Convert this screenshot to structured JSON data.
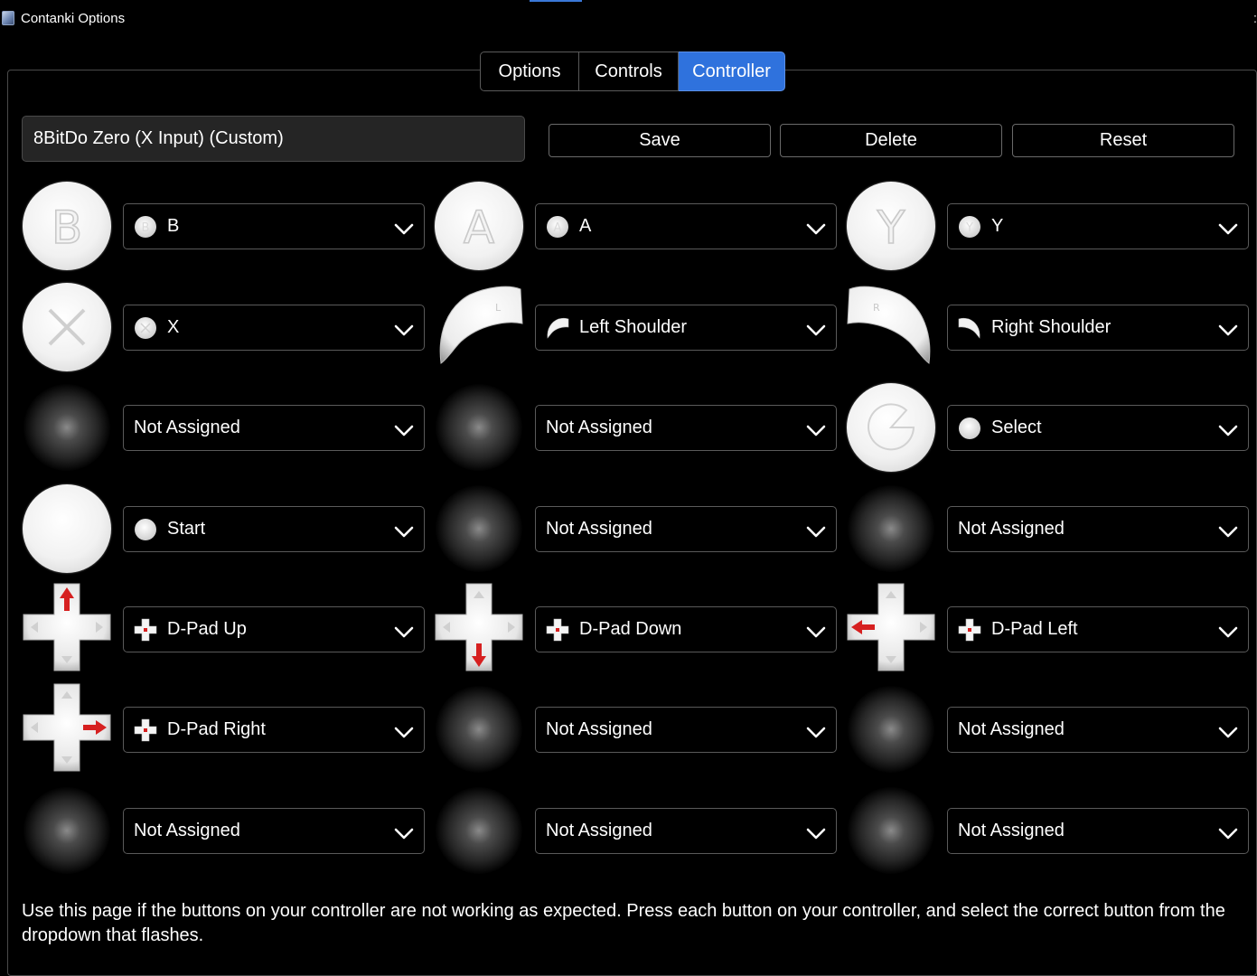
{
  "window": {
    "title": "Contanki Options"
  },
  "tabs": [
    {
      "label": "Options",
      "active": false
    },
    {
      "label": "Controls",
      "active": false
    },
    {
      "label": "Controller",
      "active": true
    }
  ],
  "profile": {
    "value": "8BitDo Zero (X Input) (Custom)"
  },
  "actions": {
    "save": "Save",
    "delete": "Delete",
    "reset": "Reset"
  },
  "colors": {
    "accent": "#2f72dd",
    "dpad_arrow": "#d62020",
    "background": "#000000"
  },
  "mappings": [
    {
      "icon": "b-button-icon",
      "dd_icon": "b-button-small-icon",
      "value": "B"
    },
    {
      "icon": "a-button-icon",
      "dd_icon": "a-button-small-icon",
      "value": "A"
    },
    {
      "icon": "y-button-icon",
      "dd_icon": "y-button-small-icon",
      "value": "Y"
    },
    {
      "icon": "x-button-icon",
      "dd_icon": "x-button-small-icon",
      "value": "X"
    },
    {
      "icon": "left-shoulder-icon",
      "dd_icon": "left-shoulder-small-icon",
      "value": "Left Shoulder"
    },
    {
      "icon": "right-shoulder-icon",
      "dd_icon": "right-shoulder-small-icon",
      "value": "Right Shoulder"
    },
    {
      "icon": "unassigned-glow-icon",
      "dd_icon": null,
      "value": "Not Assigned"
    },
    {
      "icon": "unassigned-glow-icon",
      "dd_icon": null,
      "value": "Not Assigned"
    },
    {
      "icon": "select-button-icon",
      "dd_icon": "select-small-icon",
      "value": "Select"
    },
    {
      "icon": "start-button-icon",
      "dd_icon": "start-small-icon",
      "value": "Start"
    },
    {
      "icon": "unassigned-glow-icon",
      "dd_icon": null,
      "value": "Not Assigned"
    },
    {
      "icon": "unassigned-glow-icon",
      "dd_icon": null,
      "value": "Not Assigned"
    },
    {
      "icon": "dpad-up-icon",
      "dd_icon": "dpad-small-icon",
      "value": "D-Pad Up"
    },
    {
      "icon": "dpad-down-icon",
      "dd_icon": "dpad-small-icon",
      "value": "D-Pad Down"
    },
    {
      "icon": "dpad-left-icon",
      "dd_icon": "dpad-small-icon",
      "value": "D-Pad Left"
    },
    {
      "icon": "dpad-right-icon",
      "dd_icon": "dpad-small-icon",
      "value": "D-Pad Right"
    },
    {
      "icon": "unassigned-glow-icon",
      "dd_icon": null,
      "value": "Not Assigned"
    },
    {
      "icon": "unassigned-glow-icon",
      "dd_icon": null,
      "value": "Not Assigned"
    },
    {
      "icon": "unassigned-glow-icon",
      "dd_icon": null,
      "value": "Not Assigned"
    },
    {
      "icon": "unassigned-glow-icon",
      "dd_icon": null,
      "value": "Not Assigned"
    },
    {
      "icon": "unassigned-glow-icon",
      "dd_icon": null,
      "value": "Not Assigned"
    }
  ],
  "help": {
    "text": "Use this page if the buttons on your controller are not working as expected. Press each button on your controller, and select the correct button from the dropdown that flashes."
  }
}
